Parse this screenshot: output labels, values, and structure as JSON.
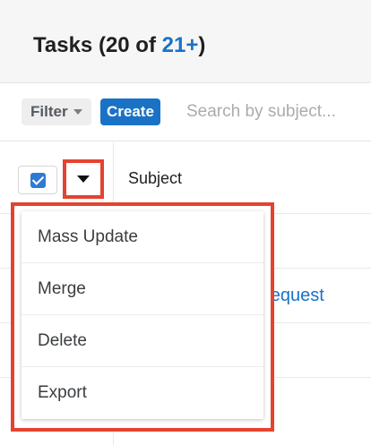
{
  "header": {
    "title": "Tasks",
    "count_prefix": "(20 of ",
    "count_total": "21+",
    "count_suffix": ")"
  },
  "toolbar": {
    "filter_label": "Filter",
    "create_label": "Create",
    "search_placeholder": "Search by subject..."
  },
  "table": {
    "subject_column": "Subject",
    "visible_link_fragments": [
      "t request",
      "..."
    ]
  },
  "actions_menu": {
    "items": [
      "Mass Update",
      "Merge",
      "Delete",
      "Export"
    ]
  },
  "colors": {
    "brand_blue": "#1a72c7",
    "highlight_red": "#e4432f"
  }
}
